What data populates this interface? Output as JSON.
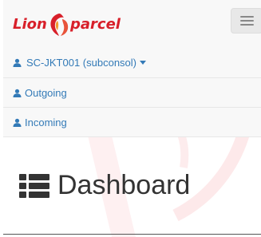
{
  "brand": {
    "name_part1": "Lion",
    "name_part2": "parcel",
    "logo_color": "#d8202a"
  },
  "nav": {
    "account_label": "SC-JKT001 (subconsol)",
    "items": [
      {
        "label": "Outgoing",
        "icon": "user-icon"
      },
      {
        "label": "Incoming",
        "icon": "user-icon"
      }
    ]
  },
  "page": {
    "title": "Dashboard",
    "title_icon": "list-icon"
  },
  "colors": {
    "link": "#337ab7",
    "navbar_bg": "#f8f8f8",
    "watermark": "#fde9ea"
  }
}
